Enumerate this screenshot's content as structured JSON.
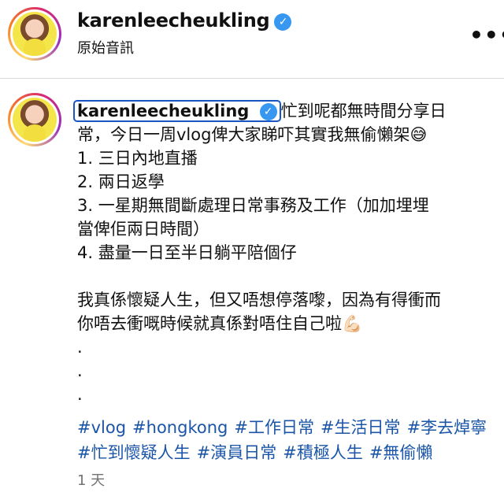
{
  "header": {
    "username": "karenleecheukling",
    "verified_glyph": "✓",
    "audio_label": "原始音訊",
    "more_glyph": "•••"
  },
  "caption": {
    "username": "karenleecheukling",
    "verified_glyph": "✓",
    "first_line": "忙到呢都無時間分享日",
    "lines": [
      "常，今日一周vlog俾大家睇吓其實我無偷懶架😅",
      "1. 三日內地直播",
      "2. 兩日返學",
      "3. 一星期無間斷處理日常事務及工作（加加埋埋",
      "當俾佢兩日時間）",
      "4. 盡量一日至半日躺平陪個仔",
      "",
      "我真係懷疑人生，但又唔想停落嚟，因為有得衝而",
      "你唔去衝嘅時候就真係對唔住自己啦💪🏻",
      ".",
      ".",
      "."
    ],
    "hashtags": [
      "#vlog",
      "#hongkong",
      "#工作日常",
      "#生活日常",
      "#李去焯寧",
      "#忙到懷疑人生",
      "#演員日常",
      "#積極人生",
      "#無偷懶"
    ]
  },
  "timestamp": "1 天",
  "colors": {
    "verified": "#3897f0",
    "hashtag": "#1a55a8",
    "highlight_border": "#1a55c4"
  }
}
